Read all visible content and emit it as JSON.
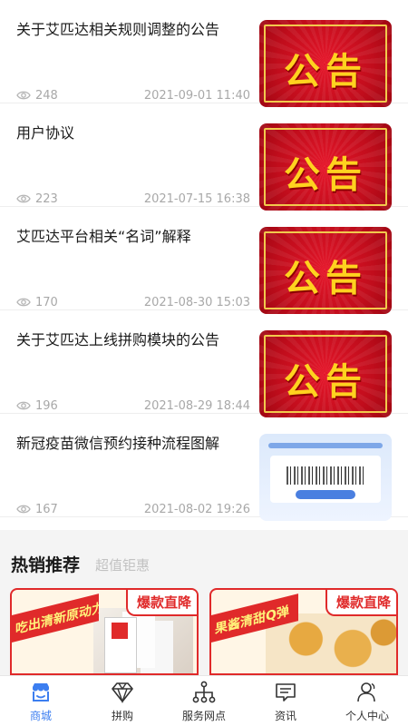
{
  "news": [
    {
      "title": "关于艾匹达相关规则调整的公告",
      "views": "248",
      "date": "2021-09-01 11:40",
      "thumb": "notice",
      "thumb_text": "公告"
    },
    {
      "title": "用户协议",
      "views": "223",
      "date": "2021-07-15 16:38",
      "thumb": "notice",
      "thumb_text": "公告"
    },
    {
      "title": "艾匹达平台相关“名词”解释",
      "views": "170",
      "date": "2021-08-30 15:03",
      "thumb": "notice",
      "thumb_text": "公告"
    },
    {
      "title": "关于艾匹达上线拼购模块的公告",
      "views": "196",
      "date": "2021-08-29 18:44",
      "thumb": "notice",
      "thumb_text": "公告"
    },
    {
      "title": "新冠疫苗微信预约接种流程图解",
      "views": "167",
      "date": "2021-08-02 19:26",
      "thumb": "vaccine"
    }
  ],
  "hot": {
    "title": "热销推荐",
    "subtitle": "超值钜惠",
    "products": [
      {
        "badge": "爆款直降",
        "slogan": "吃出清新原动力"
      },
      {
        "badge": "爆款直降",
        "slogan": "果酱清甜Q弹"
      }
    ]
  },
  "tabbar": {
    "items": [
      {
        "label": "商城",
        "icon": "shop-icon",
        "active": true
      },
      {
        "label": "拼购",
        "icon": "diamond-icon",
        "active": false
      },
      {
        "label": "服务网点",
        "icon": "network-icon",
        "active": false
      },
      {
        "label": "资讯",
        "icon": "message-icon",
        "active": false
      },
      {
        "label": "个人中心",
        "icon": "user-icon",
        "active": false
      }
    ]
  },
  "colors": {
    "accent": "#3c7ef0",
    "hot_red": "#e02a2a",
    "muted": "#a8a8a8"
  }
}
